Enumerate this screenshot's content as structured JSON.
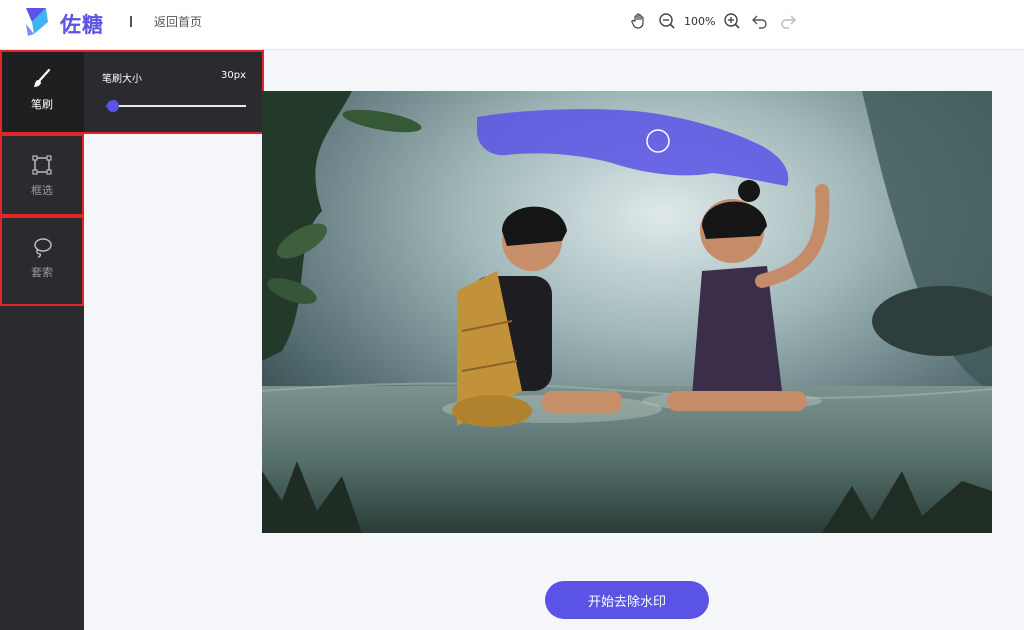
{
  "header": {
    "brand": "佐糖",
    "back_link": "返回首页",
    "zoom_level": "100%",
    "toolbar_icons": [
      "hand-icon",
      "zoom-out-icon",
      "zoom-in-icon",
      "undo-icon",
      "redo-icon"
    ]
  },
  "tools": [
    {
      "id": "brush",
      "label": "笔刷",
      "icon": "brush-icon",
      "active": true
    },
    {
      "id": "rect",
      "label": "框选",
      "icon": "rect-select-icon",
      "active": false
    },
    {
      "id": "lasso",
      "label": "套索",
      "icon": "lasso-icon",
      "active": false
    }
  ],
  "brush_panel": {
    "label": "笔刷大小",
    "value": "30px",
    "slider_level": 0.05
  },
  "action": {
    "start_label": "开始去除水印"
  },
  "colors": {
    "accent": "#5b52e6",
    "highlight_border": "#e0262b",
    "sidebar_bg": "#2b2b2f",
    "canvas_bg": "#f5f6fa"
  }
}
